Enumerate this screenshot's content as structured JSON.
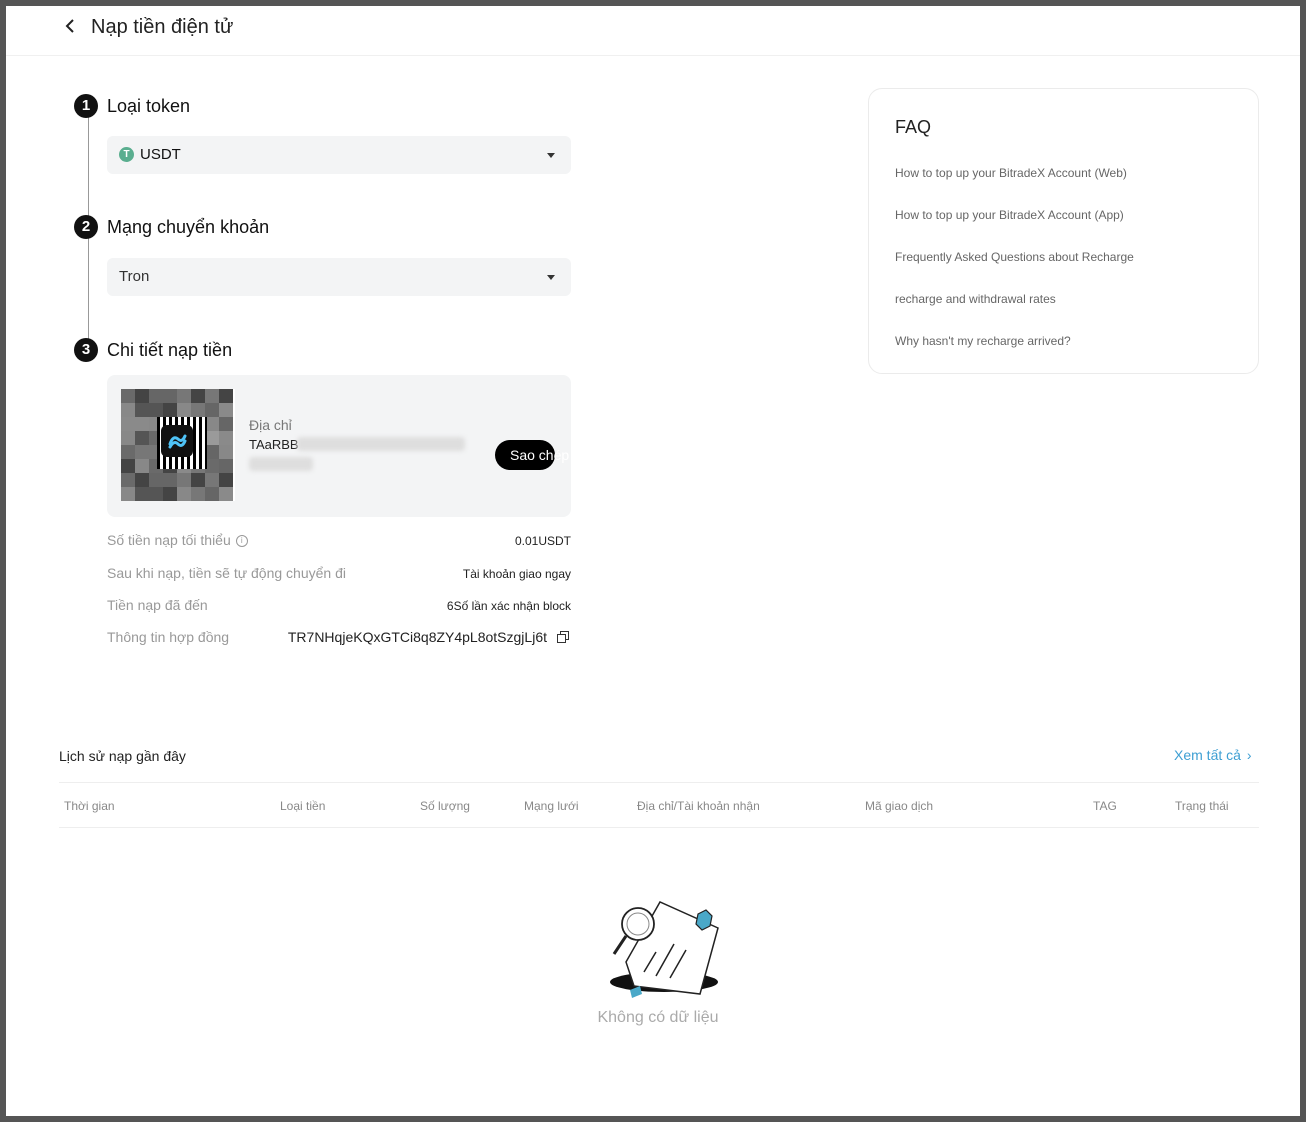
{
  "header": {
    "title": "Nạp tiền điện tử"
  },
  "steps": [
    {
      "number": "1",
      "title": "Loại token",
      "select_value": "USDT",
      "token_icon_letter": "T"
    },
    {
      "number": "2",
      "title": "Mạng chuyển khoản",
      "select_value": "Tron"
    },
    {
      "number": "3",
      "title": "Chi tiết nạp tiền"
    }
  ],
  "deposit": {
    "address_label": "Địa chỉ",
    "address_visible": "TAaRBB",
    "copy_label": "Sao chép"
  },
  "info": {
    "min_label": "Số tiền nạp tối thiểu",
    "min_value": "0.01USDT",
    "auto_label": "Sau khi nạp, tiền sẽ tự động chuyển đi",
    "auto_value": "Tài khoản giao ngay",
    "arrival_label": "Tiền nạp đã đến",
    "arrival_value": "6Số lần xác nhận block",
    "contract_label": "Thông tin hợp đồng",
    "contract_value": "TR7NHqjeKQxGTCi8q8ZY4pL8otSzgjLj6t"
  },
  "faq": {
    "title": "FAQ",
    "links": [
      "How to top up your BitradeX Account (Web)",
      "How to top up your BitradeX Account (App)",
      "Frequently Asked Questions about Recharge",
      "recharge and withdrawal rates",
      "Why hasn't my recharge arrived?"
    ]
  },
  "history": {
    "title": "Lịch sử nạp gần đây",
    "view_all": "Xem tất cả",
    "columns": [
      "Thời gian",
      "Loại tiền",
      "Số lượng",
      "Mạng lưới",
      "Địa chỉ/Tài khoản nhận",
      "Mã giao dịch",
      "TAG",
      "Trạng thái"
    ],
    "empty_text": "Không có dữ liệu"
  },
  "colors": {
    "accent": "#3e9fd3",
    "usdt": "#5aae8f",
    "empty_illustration": "#4aa8c8"
  }
}
